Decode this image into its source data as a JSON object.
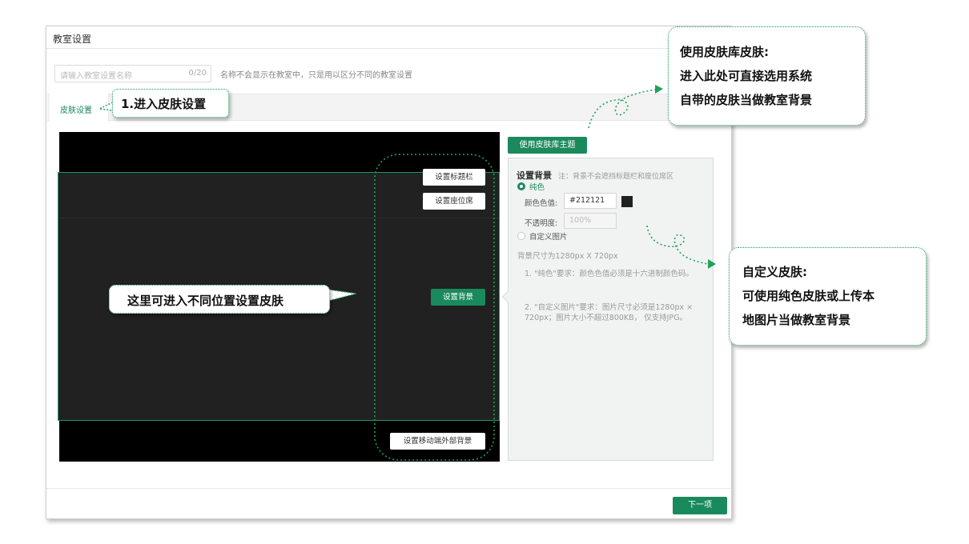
{
  "window": {
    "title": "教室设置"
  },
  "name_input": {
    "placeholder": "请输入教室设置名称",
    "counter": "0/20",
    "hint": "名称不会显示在教室中，只是用以区分不同的教室设置"
  },
  "tabs": {
    "active": "皮肤设置"
  },
  "preview": {
    "buttons": {
      "title_bar": "设置标题栏",
      "seat_area": "设置座位席",
      "background": "设置背景",
      "mobile_bg": "设置移动端外部背景"
    }
  },
  "panel": {
    "library_button": "使用皮肤库主题",
    "title": "设置背景",
    "note": "注：背景不会遮挡标题栏和座位席区",
    "options": {
      "solid": "纯色",
      "custom": "自定义图片",
      "selected": "solid"
    },
    "color_label": "颜色色值:",
    "color_value": "#212121",
    "opacity_label": "不透明度:",
    "opacity_value": "100%",
    "size_text": "背景尺寸为1280px X 720px",
    "rule1": "1. \"纯色\"要求：颜色色值必须是十六进制颜色码。",
    "rule2": "2. \"自定义图片\"要求：图片尺寸必须是1280px × 720px；图片大小不超过800KB， 仅支持JPG。"
  },
  "footer": {
    "next_button": "下一项"
  },
  "annotations": {
    "step1": "1.进入皮肤设置",
    "positions": "这里可进入不同位置设置皮肤",
    "library": [
      "使用皮肤库皮肤:",
      "进入此处可直接选用系统",
      "自带的皮肤当做教室背景"
    ],
    "custom": [
      "自定义皮肤:",
      "可使用纯色皮肤或上传本",
      "地图片当做教室背景"
    ]
  },
  "colors": {
    "accent": "#1a8a5c",
    "preview_bg": "#212121",
    "callout_border": "#21a05a"
  }
}
